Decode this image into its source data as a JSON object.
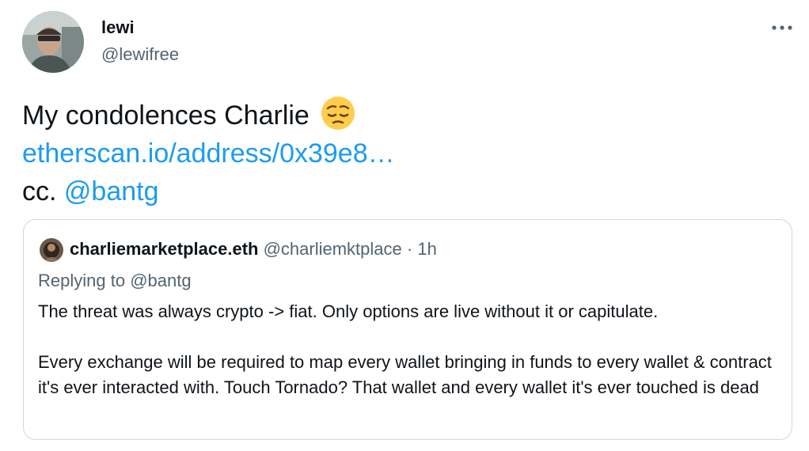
{
  "author": {
    "name": "lewi",
    "handle": "@lewifree"
  },
  "tweet": {
    "text_line1": "My condolences Charlie",
    "emoji": "pensive-face-emoji",
    "link": "etherscan.io/address/0x39e8…",
    "cc_prefix": "cc.",
    "mention": "@bantg"
  },
  "quote": {
    "name": "charliemarketplace.eth",
    "handle": "@charliemktplace",
    "separator": "·",
    "time": "1h",
    "replying_prefix": "Replying to",
    "replying_to": "@bantg",
    "paragraph1": "The threat was always crypto -> fiat. Only options are live without it or capitulate.",
    "paragraph2": "Every exchange will be required to map every wallet bringing in funds to every wallet & contract it's ever interacted with. Touch Tornado? That wallet and every wallet it's ever touched is dead"
  },
  "icons": {
    "more": "more-horizontal-icon"
  },
  "colors": {
    "link": "#1d9bf0",
    "secondary_text": "#536471",
    "primary_text": "#0f1419",
    "card_border": "#cfd9de"
  }
}
